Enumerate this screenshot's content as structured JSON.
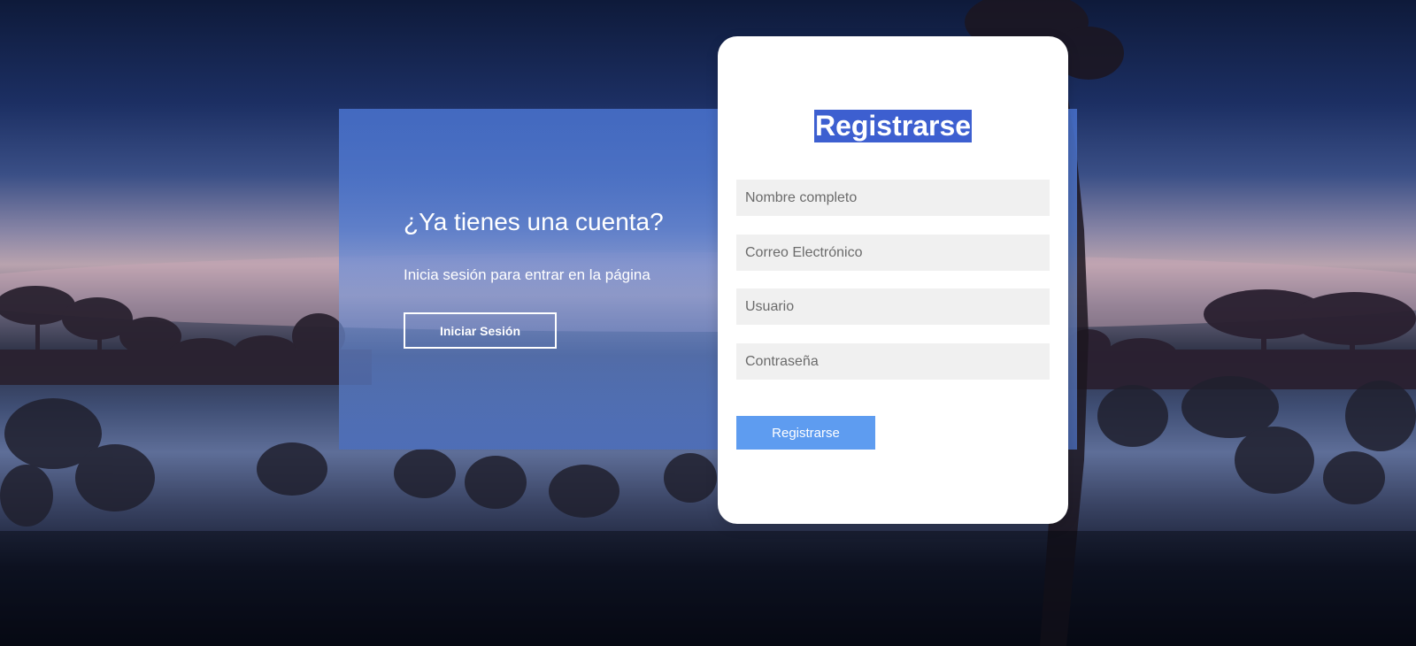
{
  "colors": {
    "panel_blue": "#466ec8",
    "title_highlight": "#3d5fd0",
    "submit_button": "#5e9cf0",
    "field_background": "#f0f0f0"
  },
  "login_panel": {
    "heading": "¿Ya tienes una cuenta?",
    "subtitle": "Inicia sesión para entrar en la página",
    "login_button_label": "Iniciar Sesión"
  },
  "register_form": {
    "title": "Registrarse",
    "fields": [
      {
        "placeholder": "Nombre completo",
        "value": ""
      },
      {
        "placeholder": "Correo Electrónico",
        "value": ""
      },
      {
        "placeholder": "Usuario",
        "value": ""
      },
      {
        "placeholder": "Contraseña",
        "value": ""
      }
    ],
    "submit_label": "Registrarse"
  }
}
